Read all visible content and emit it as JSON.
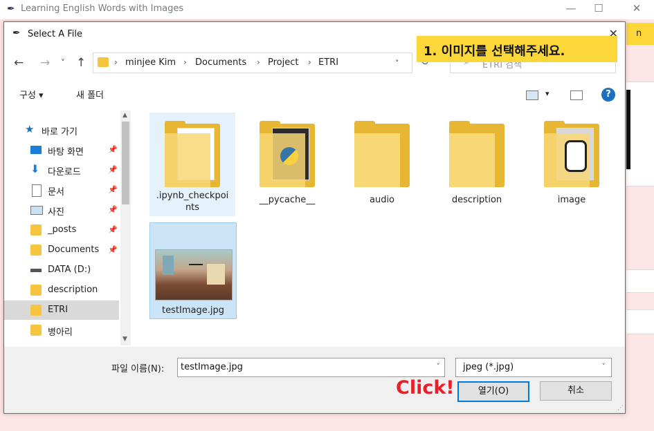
{
  "app": {
    "title": "Learning English Words with Images",
    "yellow_button_partial": "n",
    "controls": [
      "—",
      "☐",
      "✕"
    ]
  },
  "dialog": {
    "title": "Select A File",
    "close": "✕",
    "nav": {
      "back": "←",
      "forward": "→",
      "recent": "˅",
      "up": "↑"
    },
    "breadcrumb": [
      "minjee Kim",
      "Documents",
      "Project",
      "ETRI"
    ],
    "crumb_sep": "›",
    "address_chevron": "˅",
    "refresh": "↻",
    "search_placeholder": "ETRI 검색",
    "toolbar": {
      "organize": "구성 ▾",
      "new_folder": "새 폴더",
      "view_menu": "▾",
      "help": "?"
    },
    "nav_items": [
      {
        "label": "바로 가기",
        "icon": "star-icon",
        "pinned": false
      },
      {
        "label": "바탕 화면",
        "icon": "desktop-icon",
        "pinned": true
      },
      {
        "label": "다운로드",
        "icon": "download-icon",
        "pinned": true
      },
      {
        "label": "문서",
        "icon": "document-icon",
        "pinned": true
      },
      {
        "label": "사진",
        "icon": "pictures-icon",
        "pinned": true
      },
      {
        "label": "_posts",
        "icon": "folder-icon",
        "pinned": true
      },
      {
        "label": "Documents",
        "icon": "folder-icon",
        "pinned": true
      },
      {
        "label": "DATA (D:)",
        "icon": "drive-icon",
        "pinned": false
      },
      {
        "label": "description",
        "icon": "folder-icon",
        "pinned": false
      },
      {
        "label": "ETRI",
        "icon": "folder-icon",
        "pinned": false,
        "selected": true
      },
      {
        "label": "병아리",
        "icon": "folder-icon",
        "pinned": false
      }
    ],
    "files": [
      {
        "name": ".ipynb_checkpoints",
        "line1": ".ipynb_checkpoi",
        "line2": "nts",
        "icon": "folder-with-documents-icon"
      },
      {
        "name": "__pycache__",
        "icon": "folder-with-python-icon"
      },
      {
        "name": "audio",
        "icon": "folder-icon"
      },
      {
        "name": "description",
        "icon": "folder-icon"
      },
      {
        "name": "image",
        "icon": "folder-with-images-icon"
      },
      {
        "name": "testImage.jpg",
        "icon": "image-thumbnail",
        "selected": true
      }
    ],
    "filename_label": "파일 이름(N):",
    "filename_value": "testImage.jpg",
    "filetype_value": "jpeg (*.jpg)",
    "open_button": "열기(O)",
    "cancel_button": "취소"
  },
  "annotations": {
    "banner": "1. 이미지를 선택해주세요.",
    "click": "Click!"
  },
  "colors": {
    "accent_blue": "#0078d7",
    "annotation_yellow": "#fcd73a",
    "annotation_red": "#e8202a",
    "folder_yellow": "#f5c542",
    "app_background": "#fde6e6"
  }
}
